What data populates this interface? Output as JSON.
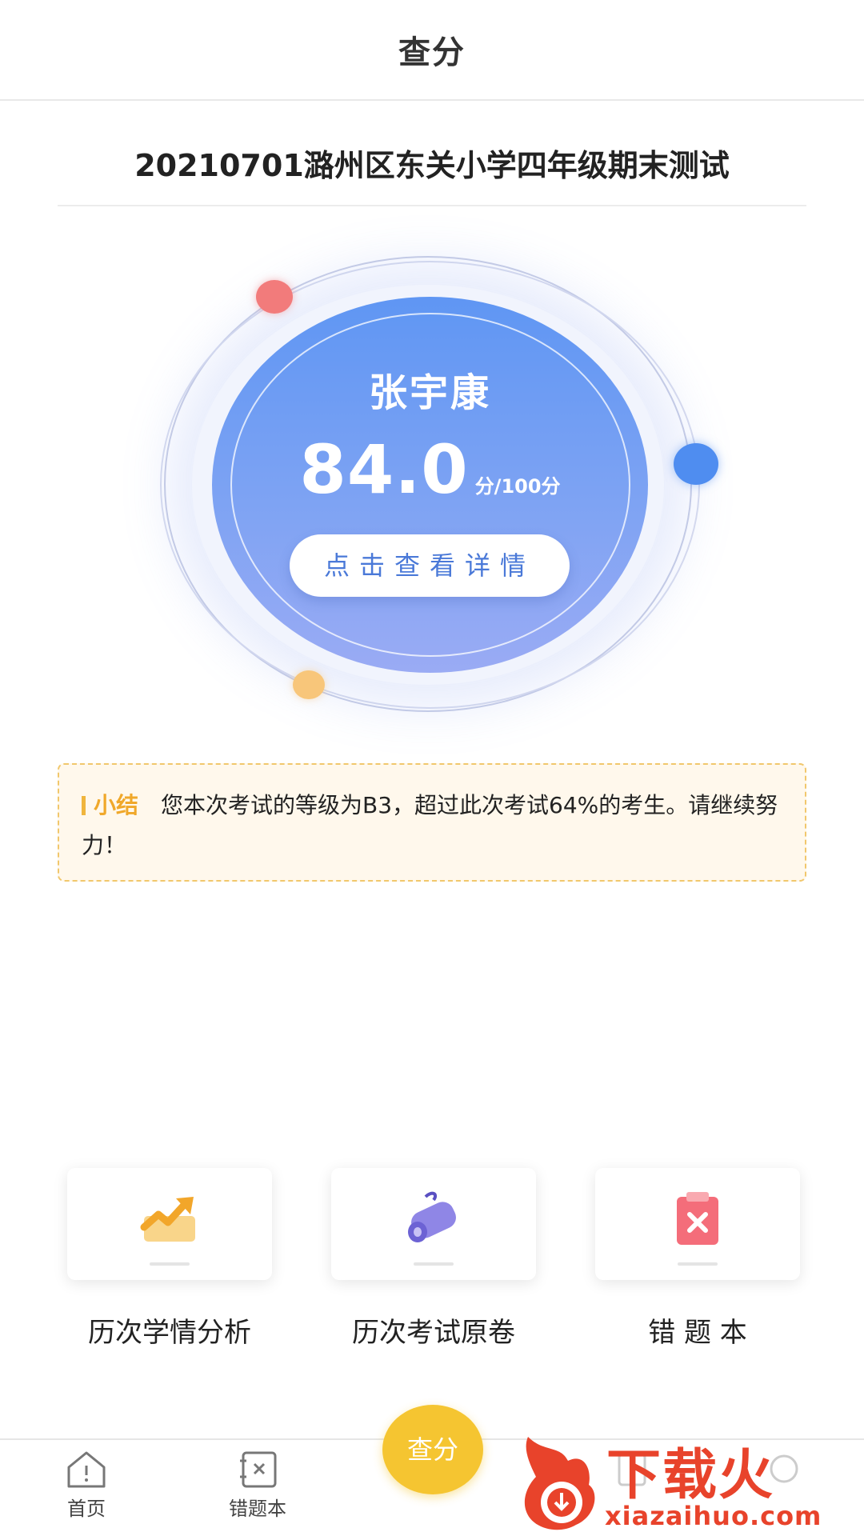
{
  "header": {
    "title": "查分"
  },
  "exam": {
    "title": "20210701潞州区东关小学四年级期末测试"
  },
  "score_card": {
    "student_name": "张宇康",
    "score": "84.0",
    "score_suffix": "分/100分",
    "detail_button": "点击查看详情"
  },
  "summary": {
    "label": "小结",
    "text": "您本次考试的等级为B3，超过此次考试64%的考生。请继续努力！"
  },
  "features": [
    {
      "label": "历次学情分析",
      "icon": "trend-chart-icon"
    },
    {
      "label": "历次考试原卷",
      "icon": "scroll-icon"
    },
    {
      "label": "错 题 本",
      "icon": "wrong-clipboard-icon"
    }
  ],
  "tabbar": {
    "items": [
      {
        "label": "首页",
        "icon": "home-icon"
      },
      {
        "label": "错题本",
        "icon": "mistake-book-icon"
      },
      {
        "label": "查分",
        "icon": "score-button"
      }
    ]
  },
  "watermark": {
    "main": "下载火",
    "sub": "xiazaihuo.com"
  },
  "colors": {
    "accent_blue": "#5f96f3",
    "accent_yellow": "#f5c531",
    "summary_orange": "#f0a82a",
    "watermark_red": "#e8432b"
  }
}
